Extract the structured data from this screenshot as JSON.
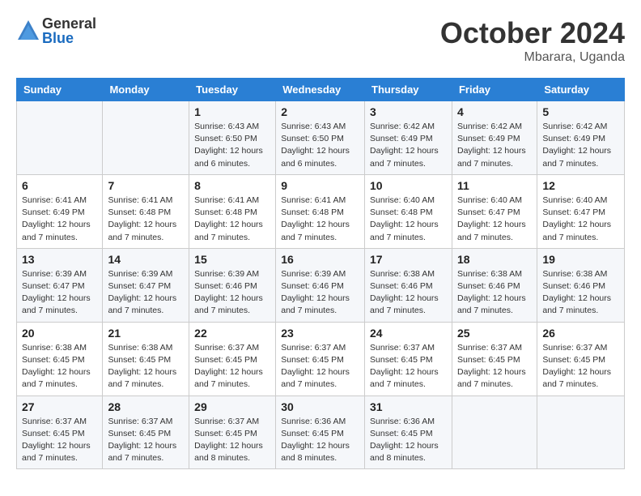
{
  "header": {
    "logo_general": "General",
    "logo_blue": "Blue",
    "month_title": "October 2024",
    "location": "Mbarara, Uganda"
  },
  "days_of_week": [
    "Sunday",
    "Monday",
    "Tuesday",
    "Wednesday",
    "Thursday",
    "Friday",
    "Saturday"
  ],
  "weeks": [
    [
      {
        "day": "",
        "info": ""
      },
      {
        "day": "",
        "info": ""
      },
      {
        "day": "1",
        "info": "Sunrise: 6:43 AM\nSunset: 6:50 PM\nDaylight: 12 hours and 6 minutes."
      },
      {
        "day": "2",
        "info": "Sunrise: 6:43 AM\nSunset: 6:50 PM\nDaylight: 12 hours and 6 minutes."
      },
      {
        "day": "3",
        "info": "Sunrise: 6:42 AM\nSunset: 6:49 PM\nDaylight: 12 hours and 7 minutes."
      },
      {
        "day": "4",
        "info": "Sunrise: 6:42 AM\nSunset: 6:49 PM\nDaylight: 12 hours and 7 minutes."
      },
      {
        "day": "5",
        "info": "Sunrise: 6:42 AM\nSunset: 6:49 PM\nDaylight: 12 hours and 7 minutes."
      }
    ],
    [
      {
        "day": "6",
        "info": "Sunrise: 6:41 AM\nSunset: 6:49 PM\nDaylight: 12 hours and 7 minutes."
      },
      {
        "day": "7",
        "info": "Sunrise: 6:41 AM\nSunset: 6:48 PM\nDaylight: 12 hours and 7 minutes."
      },
      {
        "day": "8",
        "info": "Sunrise: 6:41 AM\nSunset: 6:48 PM\nDaylight: 12 hours and 7 minutes."
      },
      {
        "day": "9",
        "info": "Sunrise: 6:41 AM\nSunset: 6:48 PM\nDaylight: 12 hours and 7 minutes."
      },
      {
        "day": "10",
        "info": "Sunrise: 6:40 AM\nSunset: 6:48 PM\nDaylight: 12 hours and 7 minutes."
      },
      {
        "day": "11",
        "info": "Sunrise: 6:40 AM\nSunset: 6:47 PM\nDaylight: 12 hours and 7 minutes."
      },
      {
        "day": "12",
        "info": "Sunrise: 6:40 AM\nSunset: 6:47 PM\nDaylight: 12 hours and 7 minutes."
      }
    ],
    [
      {
        "day": "13",
        "info": "Sunrise: 6:39 AM\nSunset: 6:47 PM\nDaylight: 12 hours and 7 minutes."
      },
      {
        "day": "14",
        "info": "Sunrise: 6:39 AM\nSunset: 6:47 PM\nDaylight: 12 hours and 7 minutes."
      },
      {
        "day": "15",
        "info": "Sunrise: 6:39 AM\nSunset: 6:46 PM\nDaylight: 12 hours and 7 minutes."
      },
      {
        "day": "16",
        "info": "Sunrise: 6:39 AM\nSunset: 6:46 PM\nDaylight: 12 hours and 7 minutes."
      },
      {
        "day": "17",
        "info": "Sunrise: 6:38 AM\nSunset: 6:46 PM\nDaylight: 12 hours and 7 minutes."
      },
      {
        "day": "18",
        "info": "Sunrise: 6:38 AM\nSunset: 6:46 PM\nDaylight: 12 hours and 7 minutes."
      },
      {
        "day": "19",
        "info": "Sunrise: 6:38 AM\nSunset: 6:46 PM\nDaylight: 12 hours and 7 minutes."
      }
    ],
    [
      {
        "day": "20",
        "info": "Sunrise: 6:38 AM\nSunset: 6:45 PM\nDaylight: 12 hours and 7 minutes."
      },
      {
        "day": "21",
        "info": "Sunrise: 6:38 AM\nSunset: 6:45 PM\nDaylight: 12 hours and 7 minutes."
      },
      {
        "day": "22",
        "info": "Sunrise: 6:37 AM\nSunset: 6:45 PM\nDaylight: 12 hours and 7 minutes."
      },
      {
        "day": "23",
        "info": "Sunrise: 6:37 AM\nSunset: 6:45 PM\nDaylight: 12 hours and 7 minutes."
      },
      {
        "day": "24",
        "info": "Sunrise: 6:37 AM\nSunset: 6:45 PM\nDaylight: 12 hours and 7 minutes."
      },
      {
        "day": "25",
        "info": "Sunrise: 6:37 AM\nSunset: 6:45 PM\nDaylight: 12 hours and 7 minutes."
      },
      {
        "day": "26",
        "info": "Sunrise: 6:37 AM\nSunset: 6:45 PM\nDaylight: 12 hours and 7 minutes."
      }
    ],
    [
      {
        "day": "27",
        "info": "Sunrise: 6:37 AM\nSunset: 6:45 PM\nDaylight: 12 hours and 7 minutes."
      },
      {
        "day": "28",
        "info": "Sunrise: 6:37 AM\nSunset: 6:45 PM\nDaylight: 12 hours and 7 minutes."
      },
      {
        "day": "29",
        "info": "Sunrise: 6:37 AM\nSunset: 6:45 PM\nDaylight: 12 hours and 8 minutes."
      },
      {
        "day": "30",
        "info": "Sunrise: 6:36 AM\nSunset: 6:45 PM\nDaylight: 12 hours and 8 minutes."
      },
      {
        "day": "31",
        "info": "Sunrise: 6:36 AM\nSunset: 6:45 PM\nDaylight: 12 hours and 8 minutes."
      },
      {
        "day": "",
        "info": ""
      },
      {
        "day": "",
        "info": ""
      }
    ]
  ]
}
